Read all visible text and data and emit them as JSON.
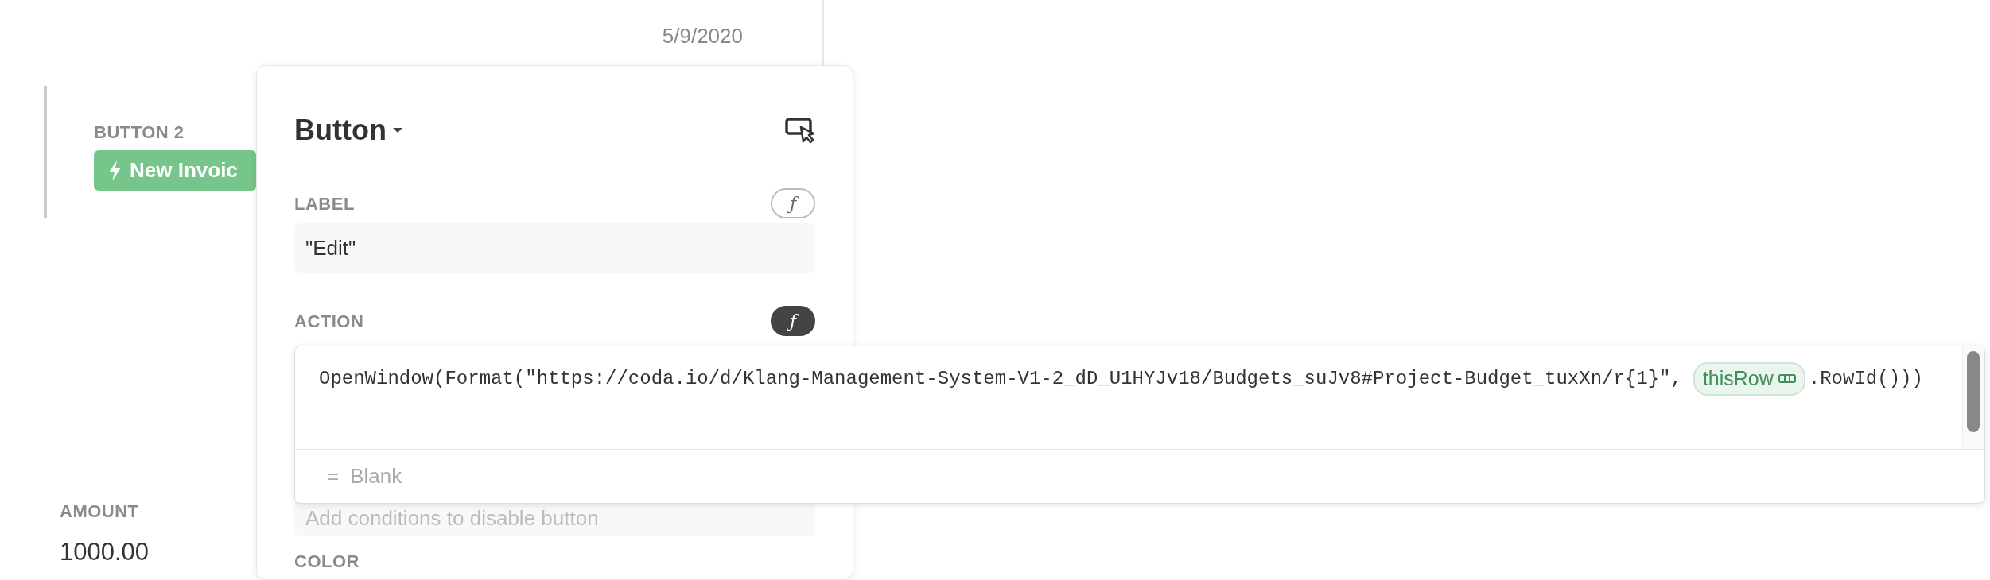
{
  "document": {
    "date": "5/9/2020",
    "button_field": {
      "label": "BUTTON 2",
      "button": "New Invoic"
    },
    "amount": {
      "label": "AMOUNT",
      "value": "1000.00"
    }
  },
  "popup": {
    "title": "Button",
    "fields": [
      {
        "label": "LABEL",
        "icon": "ƒ",
        "formula_active": false,
        "value": "\"Edit\""
      },
      {
        "label": "ACTION",
        "icon": "ƒ",
        "formula_active": true
      }
    ],
    "disable_condition": {
      "placeholder": "Add conditions to disable button"
    },
    "next_label": "COLOR"
  },
  "formula_editor": {
    "code_before": "OpenWindow(Format(\"https://coda.io/d/Klang-Management-System-V1-2_dD_U1HYJv18/Budgets_suJv8#Project-Budget_tuxXn/r{1}\",",
    "chip": "thisRow",
    "code_after": ".RowId()))",
    "result_prefix": "=",
    "result": "Blank"
  }
}
